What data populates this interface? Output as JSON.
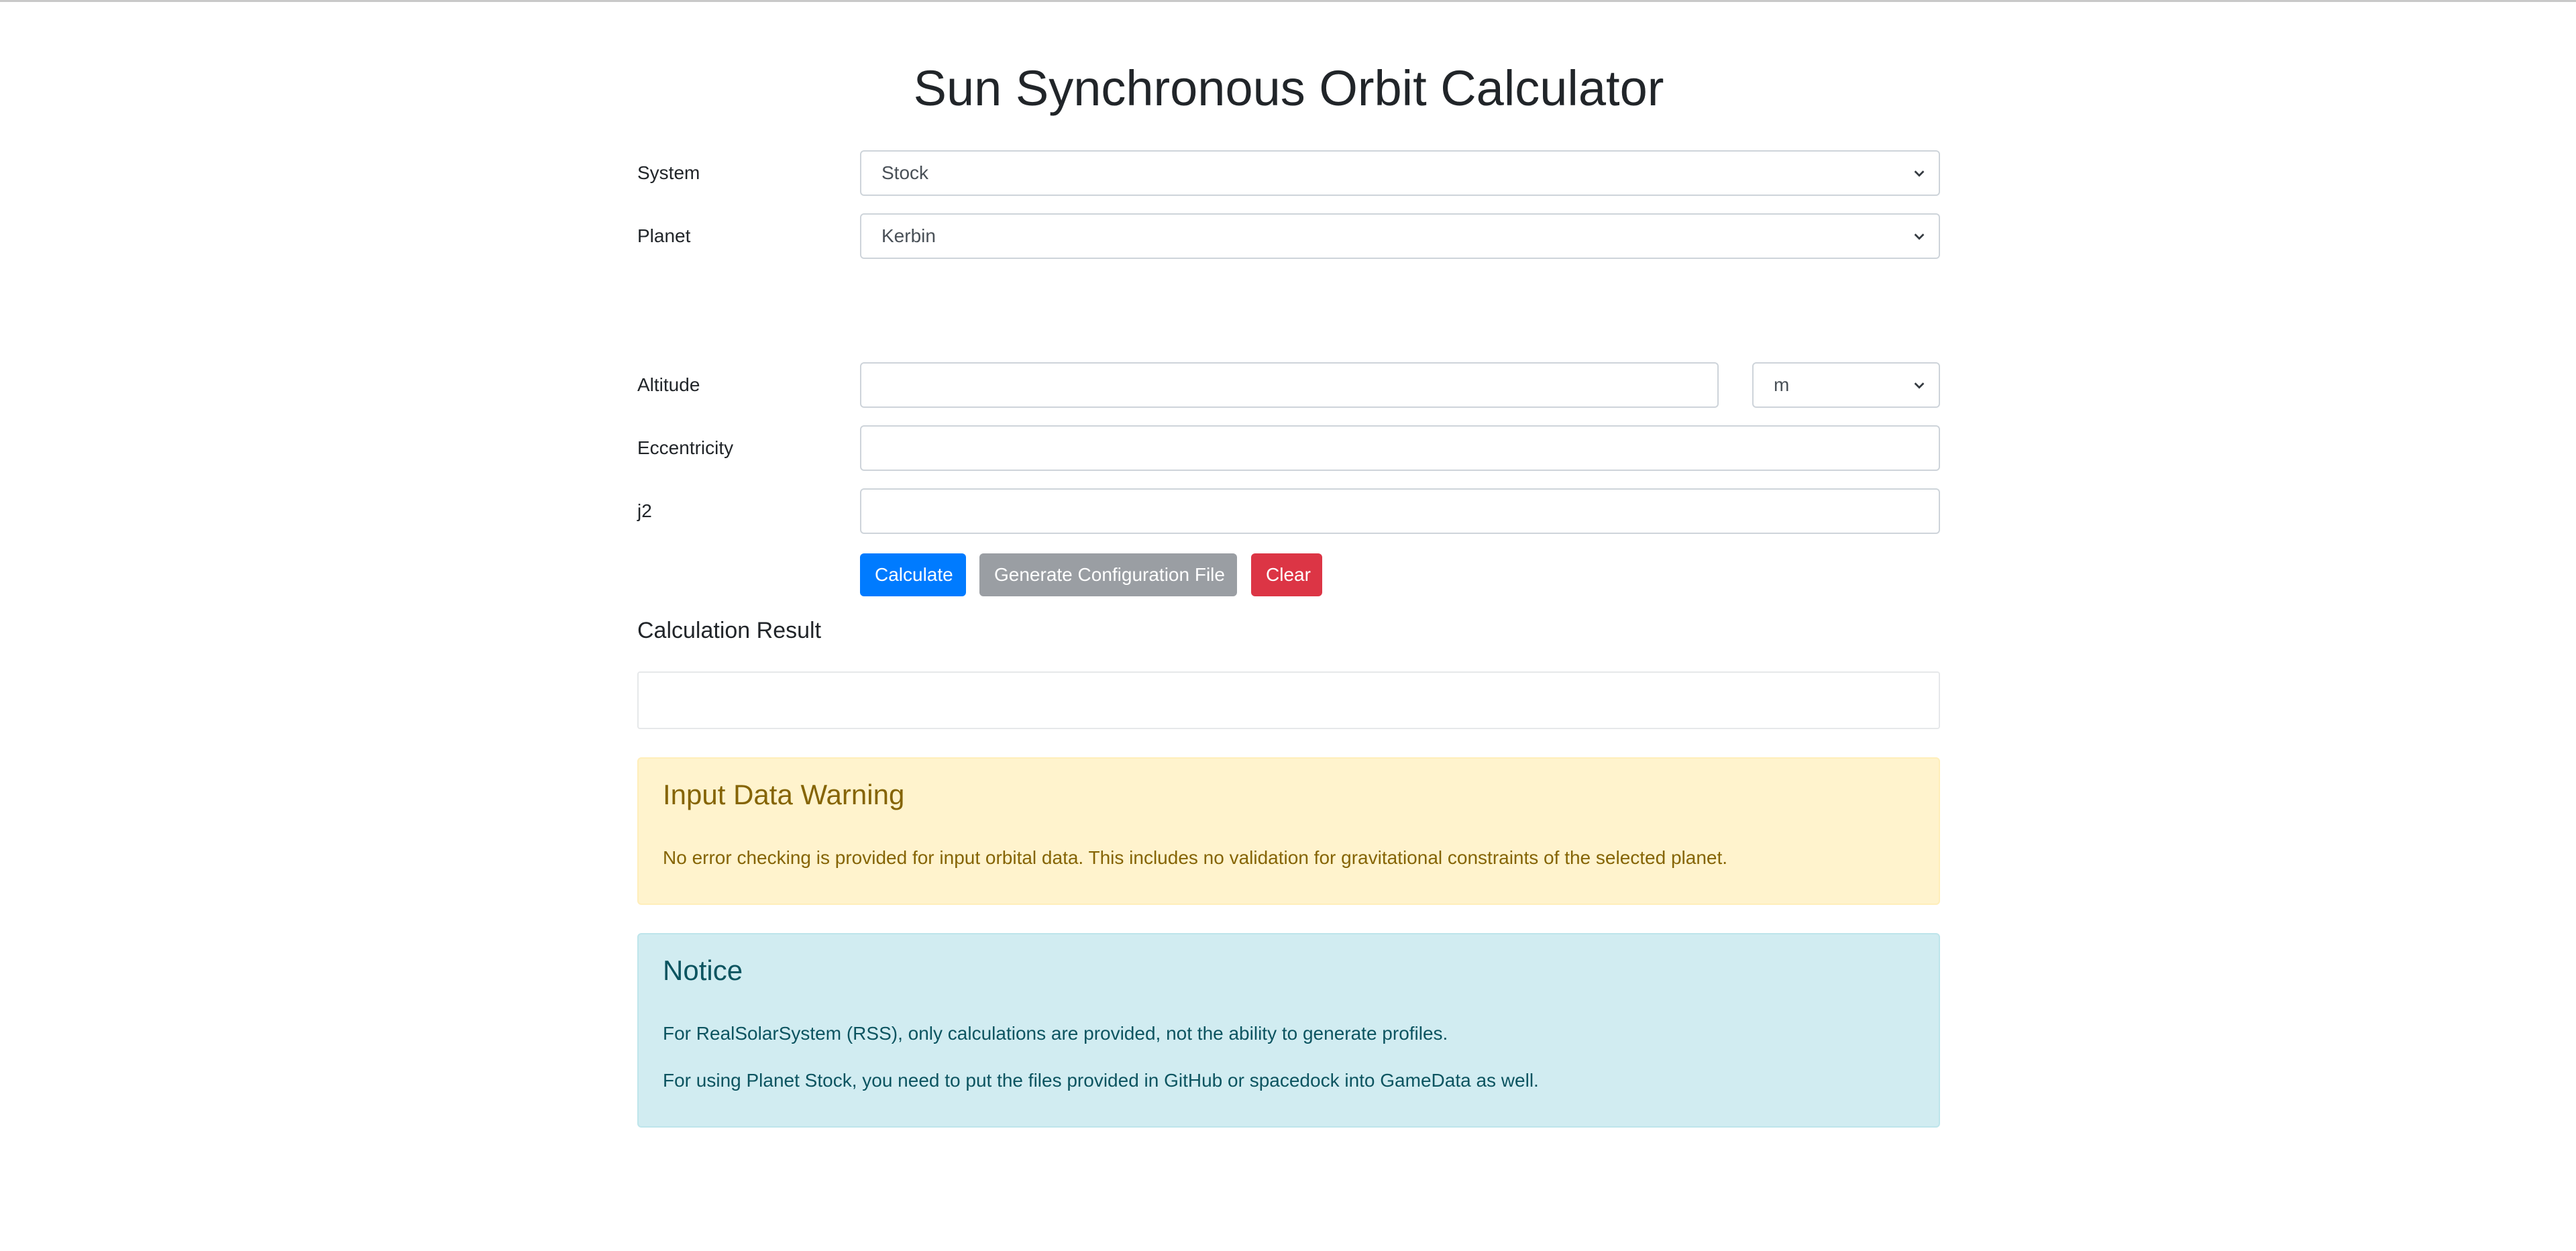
{
  "page": {
    "title": "Sun Synchronous Orbit Calculator"
  },
  "form": {
    "system": {
      "label": "System",
      "value": "Stock"
    },
    "planet": {
      "label": "Planet",
      "value": "Kerbin"
    },
    "altitude": {
      "label": "Altitude",
      "value": "",
      "unit": "m"
    },
    "eccentricity": {
      "label": "Eccentricity",
      "value": ""
    },
    "j2": {
      "label": "j2",
      "value": ""
    }
  },
  "buttons": {
    "calculate": "Calculate",
    "generate": "Generate Configuration File",
    "clear": "Clear"
  },
  "result": {
    "title": "Calculation Result",
    "value": ""
  },
  "warning": {
    "heading": "Input Data Warning",
    "text": "No error checking is provided for input orbital data. This includes no validation for gravitational constraints of the selected planet."
  },
  "notice": {
    "heading": "Notice",
    "lines": [
      "For RealSolarSystem (RSS), only calculations are provided, not the ability to generate profiles.",
      "For using Planet Stock, you need to put the files provided in GitHub or spacedock into GameData as well."
    ]
  },
  "colors": {
    "primary": "#007bff",
    "secondary": "#9a9ea3",
    "danger": "#dc3545",
    "warning_bg": "#fff3cd",
    "warning_text": "#856404",
    "info_bg": "#d1ecf1",
    "info_text": "#0c5460"
  },
  "icons": {
    "select_indicator": "chevron-down-icon"
  }
}
